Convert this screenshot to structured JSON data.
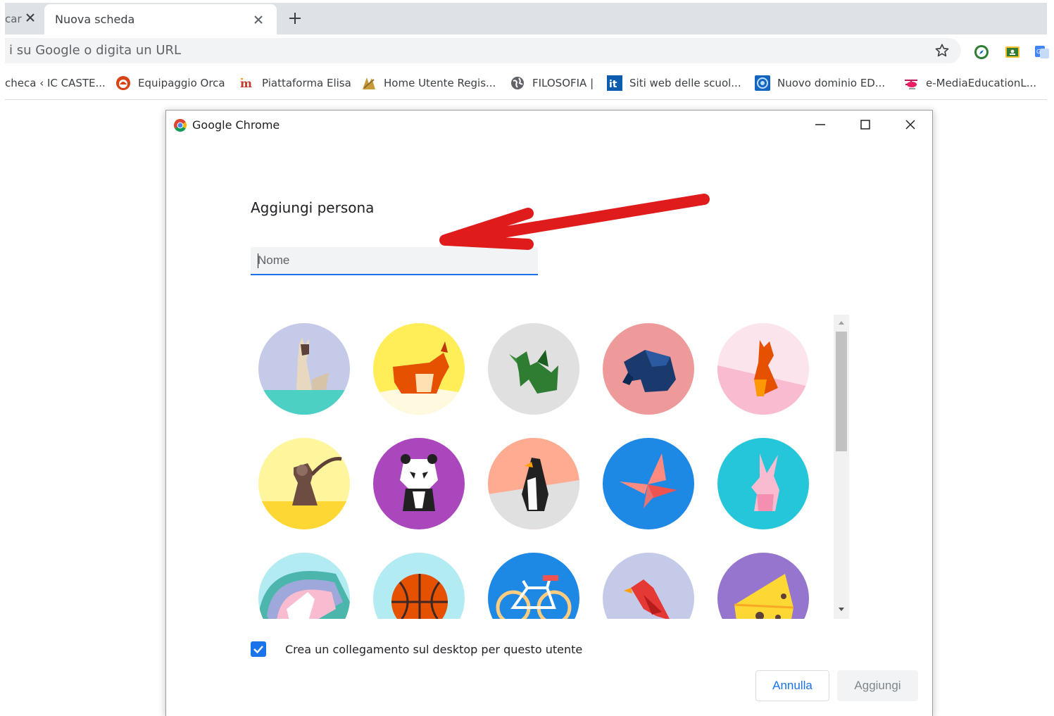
{
  "browser": {
    "prev_tab_fragment": "car",
    "active_tab_title": "Nuova scheda",
    "omnibox_placeholder": "i su Google o digita un URL"
  },
  "bookmarks": [
    {
      "label": "checa ‹ IC CASTE...",
      "icon": "page-icon"
    },
    {
      "label": "Equipaggio Orca",
      "icon": "orca-icon"
    },
    {
      "label": "Piattaforma Elisa",
      "icon": "elisa-icon"
    },
    {
      "label": "Home Utente Regis...",
      "icon": "register-icon"
    },
    {
      "label": "FILOSOFIA |",
      "icon": "globe-icon"
    },
    {
      "label": "Siti web delle scuol...",
      "icon": "it-icon"
    },
    {
      "label": "Nuovo dominio ED...",
      "icon": "emblem-icon"
    },
    {
      "label": "e-MediaEducationL...",
      "icon": "helicopter-icon"
    }
  ],
  "dialog": {
    "window_title": "Google Chrome",
    "heading": "Aggiungi persona",
    "name_placeholder": "Nome",
    "name_value": "",
    "checkbox_label": "Crea un collegamento sul desktop per questo utente",
    "checkbox_checked": true,
    "cancel_label": "Annulla",
    "add_label": "Aggiungi"
  },
  "avatars": [
    {
      "name": "cat",
      "bg": "#c5cae9"
    },
    {
      "name": "corgi",
      "bg": "#ffee58"
    },
    {
      "name": "dragon",
      "bg": "#e0e0e0"
    },
    {
      "name": "elephant",
      "bg": "#ef9a9a"
    },
    {
      "name": "fox",
      "bg": "#fce4ec"
    },
    {
      "name": "monkey",
      "bg": "#fff59d"
    },
    {
      "name": "panda",
      "bg": "#ab47bc"
    },
    {
      "name": "penguin",
      "bg": "#ffab91"
    },
    {
      "name": "butterfly",
      "bg": "#1e88e5"
    },
    {
      "name": "rabbit",
      "bg": "#26c6da"
    },
    {
      "name": "unicorn",
      "bg": "#b2ebf2"
    },
    {
      "name": "basketball",
      "bg": "#b2ebf2"
    },
    {
      "name": "bike",
      "bg": "#1e88e5"
    },
    {
      "name": "bird",
      "bg": "#c5cae9"
    },
    {
      "name": "cheese",
      "bg": "#9575cd"
    }
  ],
  "colors": {
    "accent": "#1a73e8",
    "annotation_arrow": "#e01b1b"
  }
}
